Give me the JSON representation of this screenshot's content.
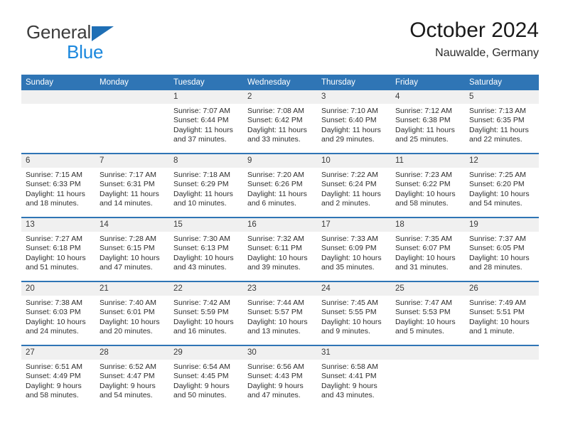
{
  "logo": {
    "word1": "General",
    "word2": "Blue",
    "triangle_color": "#1f6fb5",
    "word2_color": "#1a87dd"
  },
  "header": {
    "title": "October 2024",
    "location": "Nauwalde, Germany"
  },
  "theme": {
    "header_bar_color": "#2f75b5",
    "row_separator_color": "#2f75b5",
    "daynum_band_color": "#f0f0f0"
  },
  "weekday_headers": [
    "Sunday",
    "Monday",
    "Tuesday",
    "Wednesday",
    "Thursday",
    "Friday",
    "Saturday"
  ],
  "weeks": [
    [
      {
        "day": "",
        "sunrise": "",
        "sunset": "",
        "daylight1": "",
        "daylight2": ""
      },
      {
        "day": "",
        "sunrise": "",
        "sunset": "",
        "daylight1": "",
        "daylight2": ""
      },
      {
        "day": "1",
        "sunrise": "Sunrise: 7:07 AM",
        "sunset": "Sunset: 6:44 PM",
        "daylight1": "Daylight: 11 hours",
        "daylight2": "and 37 minutes."
      },
      {
        "day": "2",
        "sunrise": "Sunrise: 7:08 AM",
        "sunset": "Sunset: 6:42 PM",
        "daylight1": "Daylight: 11 hours",
        "daylight2": "and 33 minutes."
      },
      {
        "day": "3",
        "sunrise": "Sunrise: 7:10 AM",
        "sunset": "Sunset: 6:40 PM",
        "daylight1": "Daylight: 11 hours",
        "daylight2": "and 29 minutes."
      },
      {
        "day": "4",
        "sunrise": "Sunrise: 7:12 AM",
        "sunset": "Sunset: 6:38 PM",
        "daylight1": "Daylight: 11 hours",
        "daylight2": "and 25 minutes."
      },
      {
        "day": "5",
        "sunrise": "Sunrise: 7:13 AM",
        "sunset": "Sunset: 6:35 PM",
        "daylight1": "Daylight: 11 hours",
        "daylight2": "and 22 minutes."
      }
    ],
    [
      {
        "day": "6",
        "sunrise": "Sunrise: 7:15 AM",
        "sunset": "Sunset: 6:33 PM",
        "daylight1": "Daylight: 11 hours",
        "daylight2": "and 18 minutes."
      },
      {
        "day": "7",
        "sunrise": "Sunrise: 7:17 AM",
        "sunset": "Sunset: 6:31 PM",
        "daylight1": "Daylight: 11 hours",
        "daylight2": "and 14 minutes."
      },
      {
        "day": "8",
        "sunrise": "Sunrise: 7:18 AM",
        "sunset": "Sunset: 6:29 PM",
        "daylight1": "Daylight: 11 hours",
        "daylight2": "and 10 minutes."
      },
      {
        "day": "9",
        "sunrise": "Sunrise: 7:20 AM",
        "sunset": "Sunset: 6:26 PM",
        "daylight1": "Daylight: 11 hours",
        "daylight2": "and 6 minutes."
      },
      {
        "day": "10",
        "sunrise": "Sunrise: 7:22 AM",
        "sunset": "Sunset: 6:24 PM",
        "daylight1": "Daylight: 11 hours",
        "daylight2": "and 2 minutes."
      },
      {
        "day": "11",
        "sunrise": "Sunrise: 7:23 AM",
        "sunset": "Sunset: 6:22 PM",
        "daylight1": "Daylight: 10 hours",
        "daylight2": "and 58 minutes."
      },
      {
        "day": "12",
        "sunrise": "Sunrise: 7:25 AM",
        "sunset": "Sunset: 6:20 PM",
        "daylight1": "Daylight: 10 hours",
        "daylight2": "and 54 minutes."
      }
    ],
    [
      {
        "day": "13",
        "sunrise": "Sunrise: 7:27 AM",
        "sunset": "Sunset: 6:18 PM",
        "daylight1": "Daylight: 10 hours",
        "daylight2": "and 51 minutes."
      },
      {
        "day": "14",
        "sunrise": "Sunrise: 7:28 AM",
        "sunset": "Sunset: 6:15 PM",
        "daylight1": "Daylight: 10 hours",
        "daylight2": "and 47 minutes."
      },
      {
        "day": "15",
        "sunrise": "Sunrise: 7:30 AM",
        "sunset": "Sunset: 6:13 PM",
        "daylight1": "Daylight: 10 hours",
        "daylight2": "and 43 minutes."
      },
      {
        "day": "16",
        "sunrise": "Sunrise: 7:32 AM",
        "sunset": "Sunset: 6:11 PM",
        "daylight1": "Daylight: 10 hours",
        "daylight2": "and 39 minutes."
      },
      {
        "day": "17",
        "sunrise": "Sunrise: 7:33 AM",
        "sunset": "Sunset: 6:09 PM",
        "daylight1": "Daylight: 10 hours",
        "daylight2": "and 35 minutes."
      },
      {
        "day": "18",
        "sunrise": "Sunrise: 7:35 AM",
        "sunset": "Sunset: 6:07 PM",
        "daylight1": "Daylight: 10 hours",
        "daylight2": "and 31 minutes."
      },
      {
        "day": "19",
        "sunrise": "Sunrise: 7:37 AM",
        "sunset": "Sunset: 6:05 PM",
        "daylight1": "Daylight: 10 hours",
        "daylight2": "and 28 minutes."
      }
    ],
    [
      {
        "day": "20",
        "sunrise": "Sunrise: 7:38 AM",
        "sunset": "Sunset: 6:03 PM",
        "daylight1": "Daylight: 10 hours",
        "daylight2": "and 24 minutes."
      },
      {
        "day": "21",
        "sunrise": "Sunrise: 7:40 AM",
        "sunset": "Sunset: 6:01 PM",
        "daylight1": "Daylight: 10 hours",
        "daylight2": "and 20 minutes."
      },
      {
        "day": "22",
        "sunrise": "Sunrise: 7:42 AM",
        "sunset": "Sunset: 5:59 PM",
        "daylight1": "Daylight: 10 hours",
        "daylight2": "and 16 minutes."
      },
      {
        "day": "23",
        "sunrise": "Sunrise: 7:44 AM",
        "sunset": "Sunset: 5:57 PM",
        "daylight1": "Daylight: 10 hours",
        "daylight2": "and 13 minutes."
      },
      {
        "day": "24",
        "sunrise": "Sunrise: 7:45 AM",
        "sunset": "Sunset: 5:55 PM",
        "daylight1": "Daylight: 10 hours",
        "daylight2": "and 9 minutes."
      },
      {
        "day": "25",
        "sunrise": "Sunrise: 7:47 AM",
        "sunset": "Sunset: 5:53 PM",
        "daylight1": "Daylight: 10 hours",
        "daylight2": "and 5 minutes."
      },
      {
        "day": "26",
        "sunrise": "Sunrise: 7:49 AM",
        "sunset": "Sunset: 5:51 PM",
        "daylight1": "Daylight: 10 hours",
        "daylight2": "and 1 minute."
      }
    ],
    [
      {
        "day": "27",
        "sunrise": "Sunrise: 6:51 AM",
        "sunset": "Sunset: 4:49 PM",
        "daylight1": "Daylight: 9 hours",
        "daylight2": "and 58 minutes."
      },
      {
        "day": "28",
        "sunrise": "Sunrise: 6:52 AM",
        "sunset": "Sunset: 4:47 PM",
        "daylight1": "Daylight: 9 hours",
        "daylight2": "and 54 minutes."
      },
      {
        "day": "29",
        "sunrise": "Sunrise: 6:54 AM",
        "sunset": "Sunset: 4:45 PM",
        "daylight1": "Daylight: 9 hours",
        "daylight2": "and 50 minutes."
      },
      {
        "day": "30",
        "sunrise": "Sunrise: 6:56 AM",
        "sunset": "Sunset: 4:43 PM",
        "daylight1": "Daylight: 9 hours",
        "daylight2": "and 47 minutes."
      },
      {
        "day": "31",
        "sunrise": "Sunrise: 6:58 AM",
        "sunset": "Sunset: 4:41 PM",
        "daylight1": "Daylight: 9 hours",
        "daylight2": "and 43 minutes."
      },
      {
        "day": "",
        "sunrise": "",
        "sunset": "",
        "daylight1": "",
        "daylight2": ""
      },
      {
        "day": "",
        "sunrise": "",
        "sunset": "",
        "daylight1": "",
        "daylight2": ""
      }
    ]
  ]
}
